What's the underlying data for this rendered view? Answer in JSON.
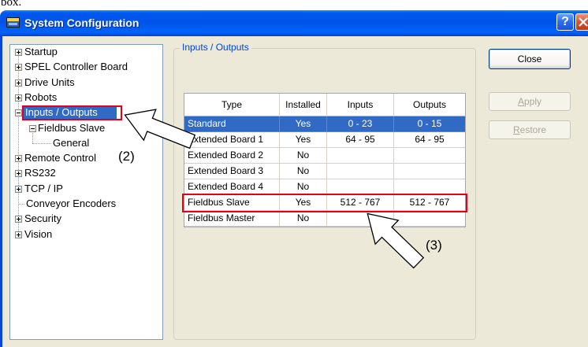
{
  "top_text": "box.",
  "window": {
    "title": "System Configuration",
    "help_label": "?",
    "icons": {
      "app": "app-icon",
      "help": "help-icon",
      "close": "close-icon"
    }
  },
  "tree": {
    "items": [
      {
        "label": "Startup",
        "icon": "expand-icon"
      },
      {
        "label": "SPEL Controller Board",
        "icon": "expand-icon"
      },
      {
        "label": "Drive Units",
        "icon": "expand-icon"
      },
      {
        "label": "Robots",
        "icon": "expand-icon"
      },
      {
        "label": "Inputs / Outputs",
        "icon": "collapse-icon",
        "selected": true
      },
      {
        "label": "Fieldbus Slave",
        "icon": "collapse-icon"
      },
      {
        "label": "General"
      },
      {
        "label": "Remote Control",
        "icon": "expand-icon"
      },
      {
        "label": "RS232",
        "icon": "expand-icon"
      },
      {
        "label": "TCP / IP",
        "icon": "expand-icon"
      },
      {
        "label": "Conveyor Encoders"
      },
      {
        "label": "Security",
        "icon": "expand-icon"
      },
      {
        "label": "Vision",
        "icon": "expand-icon"
      }
    ]
  },
  "group": {
    "title": "Inputs / Outputs"
  },
  "table": {
    "columns": [
      "Type",
      "Installed",
      "Inputs",
      "Outputs"
    ],
    "rows": [
      {
        "type": "Standard",
        "installed": "Yes",
        "inputs": "0 - 23",
        "outputs": "0 - 15"
      },
      {
        "type": "Extended Board 1",
        "installed": "Yes",
        "inputs": "64 - 95",
        "outputs": "64 - 95"
      },
      {
        "type": "Extended Board 2",
        "installed": "No",
        "inputs": "",
        "outputs": ""
      },
      {
        "type": "Extended Board 3",
        "installed": "No",
        "inputs": "",
        "outputs": ""
      },
      {
        "type": "Extended Board 4",
        "installed": "No",
        "inputs": "",
        "outputs": ""
      },
      {
        "type": "Fieldbus Slave",
        "installed": "Yes",
        "inputs": "512 - 767",
        "outputs": "512 - 767"
      },
      {
        "type": "Fieldbus Master",
        "installed": "No",
        "inputs": "",
        "outputs": ""
      }
    ],
    "selected_row_index": 0,
    "highlighted_row_index": 5
  },
  "buttons": {
    "close": "Close",
    "apply": "Apply",
    "restore": "Restore",
    "apply_enabled": false,
    "restore_enabled": false
  },
  "callouts": {
    "tree": "(2)",
    "table": "(3)"
  },
  "colors": {
    "titlebar": "#0054E3",
    "window_bg": "#ECE9D8",
    "selection": "#316AC5",
    "callout_box": "#E3001B",
    "group_title": "#0046D5"
  }
}
